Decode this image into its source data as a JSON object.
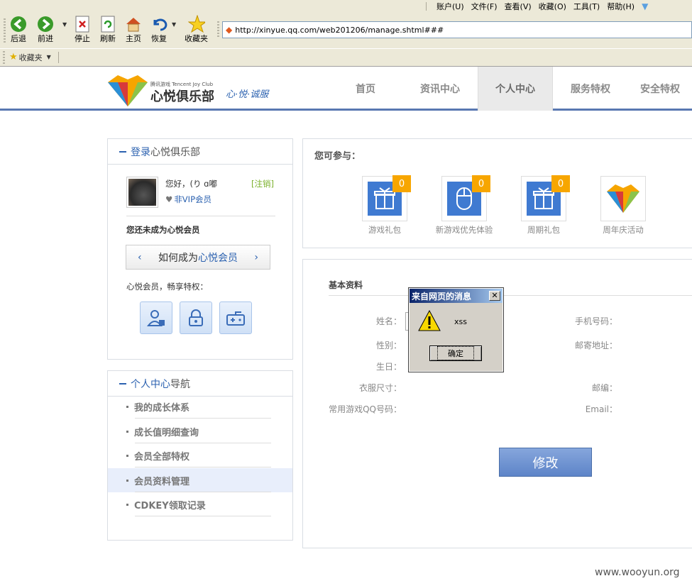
{
  "browser": {
    "menu": [
      "账户(U)",
      "文件(F)",
      "查看(V)",
      "收藏(O)",
      "工具(T)",
      "帮助(H)"
    ],
    "toolbar": {
      "back": "后退",
      "forward": "前进",
      "stop": "停止",
      "refresh": "刷新",
      "home": "主页",
      "restore": "恢复",
      "favorites": "收藏夹"
    },
    "url": "http://xinyue.qq.com/web201206/manage.shtml###",
    "favbar_label": "收藏夹"
  },
  "site": {
    "logo_small": "腾讯游戏 Tencent Joy Club",
    "logo_main": "心悦俱乐部",
    "slogan": "心·悦·诚服",
    "nav": [
      "首页",
      "资讯中心",
      "个人中心",
      "服务特权",
      "安全特权"
    ],
    "active_nav": "个人中心"
  },
  "login_panel": {
    "title_a": "登录",
    "title_b": "心悦俱乐部",
    "greeting": "您好，(り ɑ嘟",
    "logout": "[注销]",
    "vip_status": "非VIP会员",
    "not_member": "您还未成为心悦会员",
    "become_prefix": "如何成为",
    "become_highlight": "心悦会员",
    "privilege_text": "心悦会员，畅享特权："
  },
  "nav_panel": {
    "title_a": "个人中心",
    "title_b": "导航",
    "items": [
      "我的成长体系",
      "成长值明细查询",
      "会员全部特权",
      "会员资料管理",
      "CDKEY领取记录"
    ],
    "selected": "会员资料管理"
  },
  "participate": {
    "title": "您可参与：",
    "items": [
      {
        "label": "游戏礼包",
        "badge": "0",
        "icon": "gift-icon"
      },
      {
        "label": "新游戏优先体验",
        "badge": "0",
        "icon": "mouse-icon"
      },
      {
        "label": "周期礼包",
        "badge": "0",
        "icon": "gift-icon"
      },
      {
        "label": "周年庆活动",
        "badge": "",
        "icon": "diamond-logo-icon"
      }
    ]
  },
  "profile": {
    "title": "基本资料",
    "left_labels": [
      "姓名：",
      "性别：",
      "生日：",
      "衣服尺寸：",
      "常用游戏QQ号码："
    ],
    "right_labels": [
      "手机号码：",
      "邮寄地址：",
      "邮编：",
      "Email："
    ],
    "submit": "修改"
  },
  "dialog": {
    "title": "来自网页的消息",
    "message": "xss",
    "ok": "确定",
    "icon": "warning-icon"
  },
  "watermark": "www.wooyun.org",
  "colors": {
    "accent": "#2c62b0",
    "nav_active_bg": "#eaeaea",
    "badge": "#f7a600",
    "button": "#6a8fce"
  }
}
